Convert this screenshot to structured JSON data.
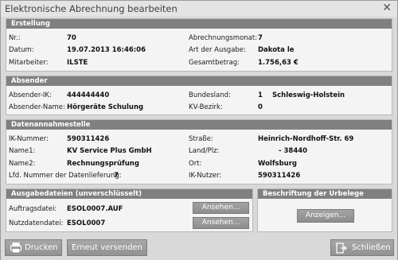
{
  "window": {
    "title": "Elektronische Abrechnung bearbeiten",
    "close_glyph": "✕"
  },
  "erstellung": {
    "header": "Erstellung",
    "nr_label": "Nr.:",
    "nr_value": "70",
    "datum_label": "Datum:",
    "datum_value": "19.07.2013 16:46:06",
    "mitarbeiter_label": "Mitarbeiter:",
    "mitarbeiter_value": "ILSTE",
    "abrechnungsmonat_label": "Abrechnungsmonat:",
    "abrechnungsmonat_value": "7",
    "art_label": "Art der Ausgabe:",
    "art_value": "Dakota le",
    "gesamtbetrag_label": "Gesamtbetrag:",
    "gesamtbetrag_value": "1.756,63 €"
  },
  "absender": {
    "header": "Absender",
    "ik_label": "Absender-IK:",
    "ik_value": "444444440",
    "name_label": "Absender-Name:",
    "name_value": "Hörgeräte Schulung",
    "bundesland_label": "Bundesland:",
    "bundesland_num": "1",
    "bundesland_value": "Schleswig-Holstein",
    "kv_label": "KV-Bezirk:",
    "kv_value": "0"
  },
  "datenannahme": {
    "header": "Datenannahmestelle",
    "ik_label": "IK-Nummer:",
    "ik_value": "590311426",
    "name1_label": "Name1:",
    "name1_value": "KV Service Plus GmbH",
    "name2_label": "Name2:",
    "name2_value": "Rechnungsprüfung",
    "lfd_label": "Lfd. Nummer der Datenlieferung:",
    "lfd_value": "7",
    "strasse_label": "Straße:",
    "strasse_value": "Heinrich-Nordhoff-Str. 69",
    "landplz_label": "Land/Plz:",
    "landplz_value": "-  38440",
    "ort_label": "Ort:",
    "ort_value": "Wolfsburg",
    "iknutzer_label": "IK-Nutzer:",
    "iknutzer_value": "590311426"
  },
  "ausgabe": {
    "header": "Ausgabedateien (unverschlüsselt)",
    "auftrag_label": "Auftragsdatei:",
    "auftrag_value": "ESOL0007.AUF",
    "nutz_label": "Nutzdatendatei:",
    "nutz_value": "ESOL0007",
    "ansehen1": "Ansehen...",
    "ansehen2": "Ansehen..."
  },
  "urbelege": {
    "header": "Beschriftung der Urbelege",
    "anzeigen": "Anzeigen..."
  },
  "buttons": {
    "drucken": "Drucken",
    "erneut": "Erneut versenden",
    "schliessen": "Schließen"
  }
}
